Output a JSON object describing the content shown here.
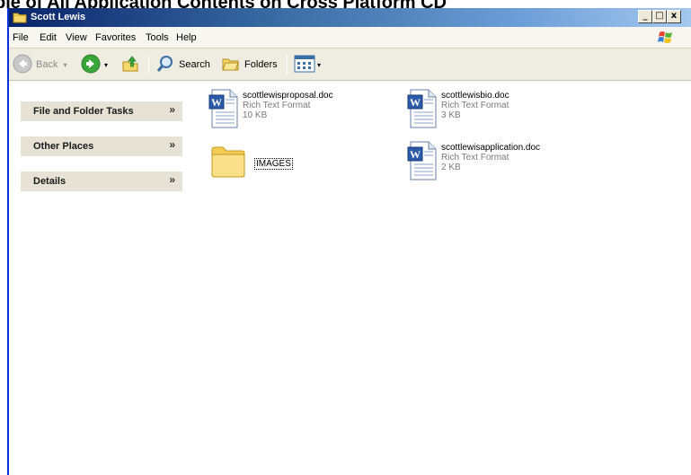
{
  "doc_title": "ble of All Application Contents on Cross Platform CD",
  "window": {
    "title": "Scott Lewis",
    "min": "_",
    "max": "□",
    "close": "x"
  },
  "menu": {
    "file": "File",
    "edit": "Edit",
    "view": "View",
    "favorites": "Favorites",
    "tools": "Tools",
    "help": "Help"
  },
  "toolbar": {
    "back": "Back",
    "search": "Search",
    "folders": "Folders"
  },
  "sidebar": {
    "panels": [
      {
        "label": "File and Folder Tasks",
        "chevron": "»"
      },
      {
        "label": "Other Places",
        "chevron": "»"
      },
      {
        "label": "Details",
        "chevron": "»"
      }
    ]
  },
  "files": [
    {
      "name": "scottlewisproposal.doc",
      "type": "Rich Text Format",
      "size": "10 KB"
    },
    {
      "name": "scottlewisbio.doc",
      "type": "Rich Text Format",
      "size": "3 KB"
    },
    {
      "name": "scottlewisapplication.doc",
      "type": "Rich Text Format",
      "size": "2 KB"
    }
  ],
  "folders": [
    {
      "name": "IMAGES"
    }
  ],
  "colors": {
    "titlebar_start": "#0a246a",
    "titlebar_end": "#a6caf0",
    "panel_bg": "#e6e3d6",
    "toolbar_bg": "#efede2"
  }
}
